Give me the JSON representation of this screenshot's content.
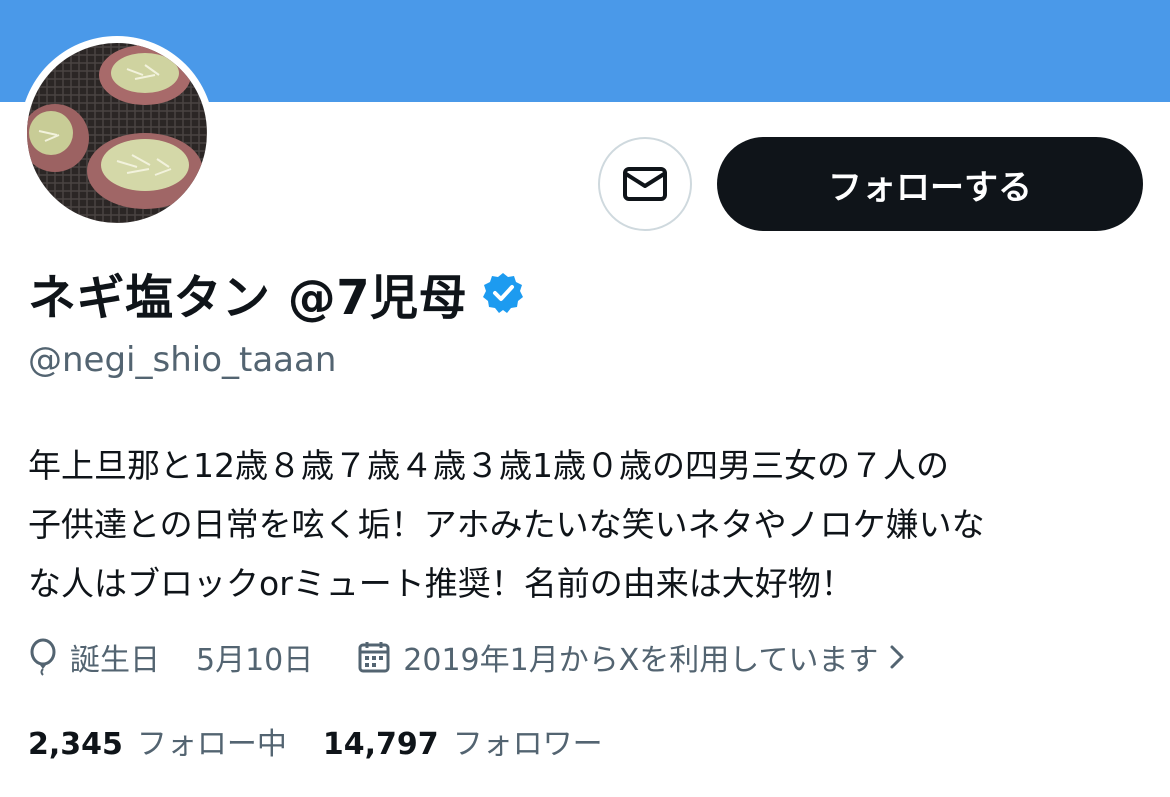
{
  "profile": {
    "display_name": "ネギ塩タン @7児母",
    "handle": "@negi_shio_taaan",
    "verified_icon": "verified-badge-icon",
    "bio_lines": [
      "年上旦那と12歳８歳７歳４歳３歳1歳０歳の四男三女の７人の",
      "子供達との日常を呟く垢！アホみたいな笑いネタやノロケ嫌いな",
      "な人はブロックorミュート推奨！名前の由来は大好物！"
    ],
    "birthday_label": "誕生日",
    "birthday_value": "5月10日",
    "joined_text": "2019年1月からXを利用しています"
  },
  "actions": {
    "message_icon": "envelope-icon",
    "follow_label": "フォローする"
  },
  "stats": {
    "following_count": "2,345",
    "following_label": "フォロー中",
    "followers_count": "14,797",
    "followers_label": "フォロワー"
  },
  "colors": {
    "banner": "#4a99e9",
    "accent": "#1d9bf0",
    "follow_button": "#0f1419",
    "secondary_text": "#536471"
  }
}
